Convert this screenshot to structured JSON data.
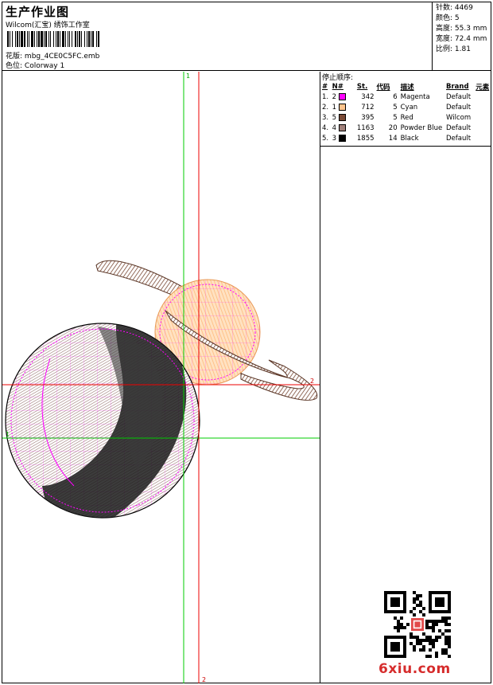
{
  "header": {
    "title": "生产作业图",
    "company": "Wilcom(汇宝) 绣饰工作室",
    "design_label": "花版:",
    "design_name": "mbg_4CE0C5FC.emb",
    "colorway_label": "色位:",
    "colorway_name": "Colorway 1"
  },
  "stats": [
    {
      "label": "针数:",
      "value": "4469"
    },
    {
      "label": "颜色:",
      "value": "5"
    },
    {
      "label": "高度:",
      "value": "55.3 mm"
    },
    {
      "label": "宽度:",
      "value": "72.4 mm"
    },
    {
      "label": "比例:",
      "value": "1.81"
    }
  ],
  "sequence": {
    "title": "停止顺序:",
    "headers": [
      "#",
      "N#",
      "St.",
      "代码",
      "描述",
      "Brand",
      "元素"
    ],
    "rows": [
      {
        "num": "1.",
        "n": "2",
        "color": "#ff00ff",
        "st": "342",
        "code": "6",
        "desc": "Magenta",
        "brand": "Default"
      },
      {
        "num": "2.",
        "n": "1",
        "color": "#ffc48c",
        "st": "712",
        "code": "5",
        "desc": "Cyan",
        "brand": "Default"
      },
      {
        "num": "3.",
        "n": "5",
        "color": "#7a4a35",
        "st": "395",
        "code": "5",
        "desc": "Red",
        "brand": "Wilcom"
      },
      {
        "num": "4.",
        "n": "4",
        "color": "#a0807a",
        "st": "1163",
        "code": "20",
        "desc": "Powder Blue",
        "brand": "Default"
      },
      {
        "num": "5.",
        "n": "3",
        "color": "#000000",
        "st": "1855",
        "code": "14",
        "desc": "Black",
        "brand": "Default"
      }
    ]
  },
  "guides": {
    "green_v_label": "1",
    "green_h_label": "1",
    "red_h_label": "2",
    "red_v_label": "2"
  },
  "watermark": "6xiu.com",
  "colors": {
    "green_guide": "#00cc00",
    "red_guide": "#ee0000",
    "magenta": "#ff00ff",
    "peach": "#ffc48c",
    "brown": "#7a4a35",
    "mauve": "#a0807a"
  }
}
